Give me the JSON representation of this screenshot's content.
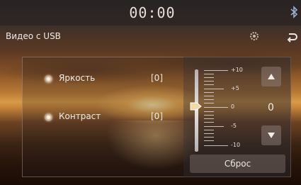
{
  "status_bar": {
    "clock": "00:00"
  },
  "title_bar": {
    "title": "Видео с USB"
  },
  "settings": {
    "rows": [
      {
        "label": "Яркость",
        "value": "[0]"
      },
      {
        "label": "Контраст",
        "value": "[0]"
      }
    ],
    "scale": {
      "labels": [
        "+10",
        "+5",
        "0",
        "-5",
        "-10"
      ],
      "current_value": "0"
    },
    "reset_label": "Сброс"
  },
  "icons": {
    "bluetooth": "bluetooth-icon",
    "settings": "settings-gear-icon",
    "back": "back-arrow-icon",
    "up": "triangle-up-icon",
    "down": "triangle-down-icon"
  },
  "colors": {
    "text": "#f1ebe6",
    "panel_border": "#b4a096"
  }
}
